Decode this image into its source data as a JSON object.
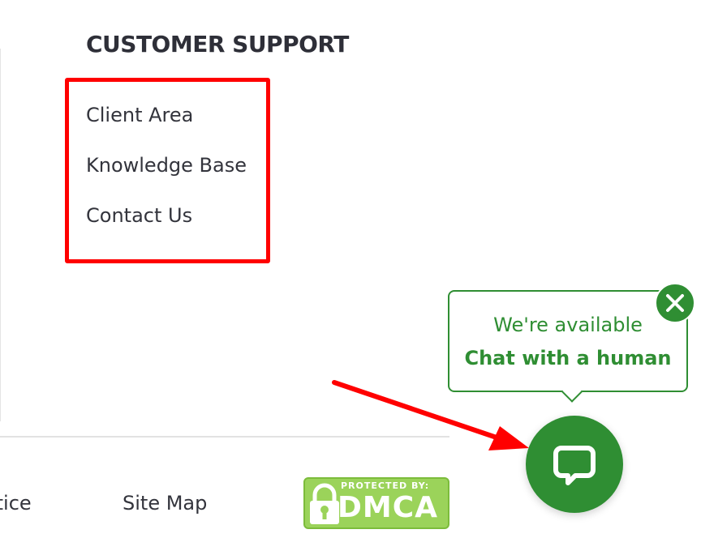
{
  "support": {
    "title": "CUSTOMER SUPPORT",
    "links": [
      {
        "label": "Client Area"
      },
      {
        "label": "Knowledge Base"
      },
      {
        "label": "Contact Us"
      }
    ]
  },
  "footer": {
    "partial_link": "Notice",
    "sitemap_link": "Site Map",
    "dmca": {
      "top_text": "PROTECTED BY:",
      "main_text": "DMCA"
    }
  },
  "chat": {
    "availability": "We're available",
    "cta": "Chat with a human",
    "close_icon": "close-icon",
    "launcher_icon": "chat-bubble-icon",
    "brand_color": "#2f8e33"
  },
  "annotations": {
    "highlight_color": "#ff0000",
    "arrow_color": "#ff0000"
  }
}
